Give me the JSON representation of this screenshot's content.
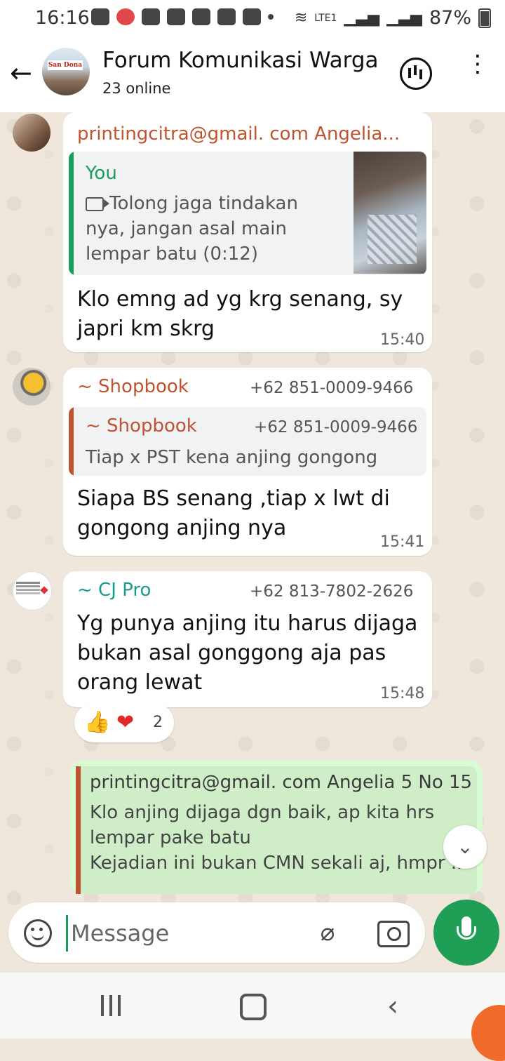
{
  "status_bar": {
    "time": "16:16",
    "battery": "87%",
    "network": "LTE1"
  },
  "header": {
    "back_icon": "arrow-left-icon",
    "group_name": "Forum Komunikasi Warga",
    "subtitle": "23 online",
    "avatar_sign": "San Dona"
  },
  "messages": [
    {
      "sender": "printingcitra@gmail. com Angelia...",
      "sender_color": "#c0532f",
      "quote": {
        "author": "You",
        "author_color": "#1a9e5c",
        "text": "Tolong jaga tindakan\nnya, jangan asal main\nlempar batu (0:12)",
        "has_video_thumb": true
      },
      "text": "Klo emng ad yg krg senang, sy\njapri km skrg",
      "time": "15:40"
    },
    {
      "sender": "~ Shopbook",
      "sender_color": "#c0532f",
      "phone": "+62 851-0009-9466",
      "quote": {
        "author": "~ Shopbook",
        "author_color": "#c0532f",
        "phone": "+62 851-0009-9466",
        "text": "Tiap x PST kena anjing gongong"
      },
      "text": "Siapa BS senang ,tiap x lwt di\ngongong anjing nya",
      "time": "15:41"
    },
    {
      "sender": "~ CJ Pro",
      "sender_color": "#1a9e8c",
      "phone": "+62 813-7802-2626",
      "text": "Yg punya anjing itu harus dijaga\nbukan asal gonggong aja pas\norang lewat",
      "time": "15:48",
      "reactions": {
        "emojis": [
          "👍",
          "❤"
        ],
        "count": "2"
      }
    }
  ],
  "outgoing": {
    "quote_author": "printingcitra@gmail. com Angelia 5 No 15",
    "quote_text": "Klo anjing dijaga dgn baik, ap kita hrs\nlempar pake batu\nKejadian ini bukan CMN sekali aj, hmpr ..."
  },
  "composer": {
    "placeholder": "Message"
  },
  "colors": {
    "accent_green": "#1e9f55",
    "outgoing_bubble": "#d9fdd3",
    "chat_bg": "#efe7dc"
  }
}
